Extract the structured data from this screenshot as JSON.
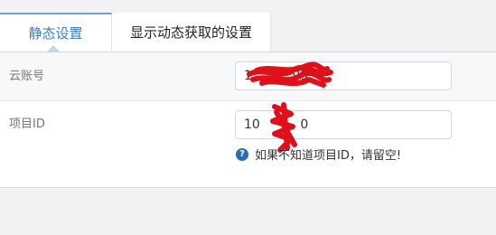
{
  "tabs": [
    {
      "label": "静态设置"
    },
    {
      "label": "显示动态获取的设置"
    }
  ],
  "fields": {
    "cloud_account": {
      "label": "云账号",
      "value": "1          99"
    },
    "project_id": {
      "label": "项目ID",
      "value": "10          0"
    }
  },
  "hint": {
    "icon": "question-circle-icon",
    "text": "如果不知道项目ID，请留空!"
  },
  "colors": {
    "accent": "#3b7cc4",
    "panel_border": "#c6d7ee",
    "hint_icon": "#2a6cb5",
    "redaction": "#e0101b"
  }
}
